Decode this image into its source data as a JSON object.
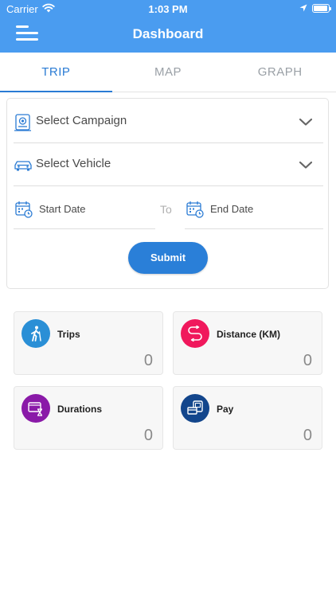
{
  "status_bar": {
    "carrier": "Carrier",
    "time": "1:03 PM",
    "battery_level": 0.95
  },
  "header": {
    "title": "Dashboard",
    "background": "#4a9cf0"
  },
  "tabs": [
    {
      "label": "TRIP",
      "active": true
    },
    {
      "label": "MAP",
      "active": false
    },
    {
      "label": "GRAPH",
      "active": false
    }
  ],
  "form": {
    "campaign": {
      "label": "Select Campaign",
      "icon": "campaign-icon"
    },
    "vehicle": {
      "label": "Select Vehicle",
      "icon": "car-icon"
    },
    "start_date": {
      "label": "Start Date",
      "icon": "calendar-icon"
    },
    "to_label": "To",
    "end_date": {
      "label": "End Date",
      "icon": "calendar-icon"
    },
    "submit_label": "Submit"
  },
  "stats": {
    "trips": {
      "label": "Trips",
      "value": "0",
      "color": "#2a8fd6",
      "icon": "walking-icon"
    },
    "distance": {
      "label": "Distance (KM)",
      "value": "0",
      "color": "#f0185c",
      "icon": "route-icon"
    },
    "durations": {
      "label": "Durations",
      "value": "0",
      "color": "#8a1aa8",
      "icon": "hourglass-icon"
    },
    "pay": {
      "label": "Pay",
      "value": "0",
      "color": "#13468c",
      "icon": "payment-icon"
    }
  }
}
